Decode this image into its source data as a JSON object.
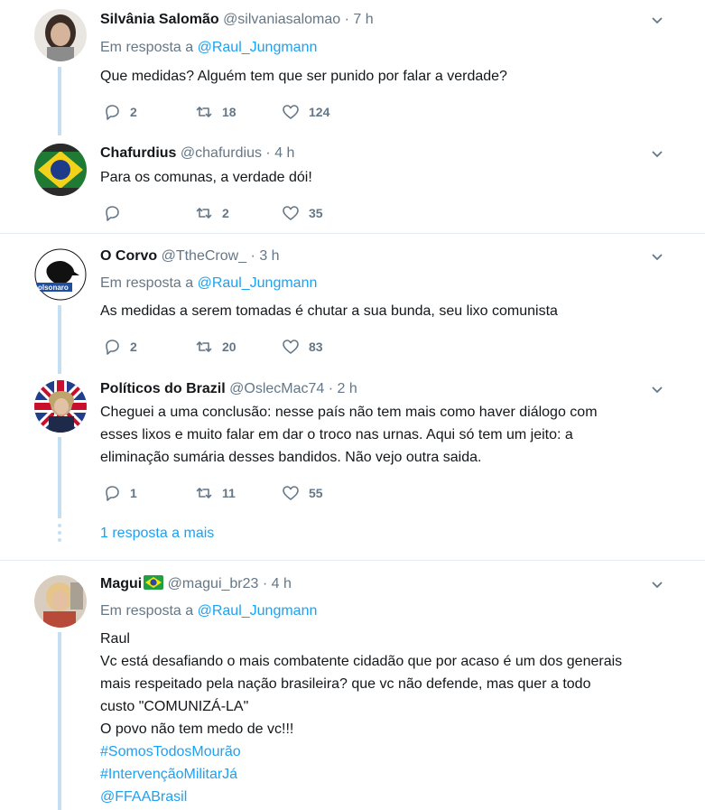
{
  "tweets": [
    {
      "name": "Silvânia Salomão",
      "handle": "@silvaniasalomao",
      "time": "7 h",
      "reply_prefix": "Em resposta a",
      "reply_to": "@Raul_Jungmann",
      "text": [
        "Que medidas? Alguém tem que ser punido por falar a verdade?"
      ],
      "replies": "2",
      "retweets": "18",
      "likes": "124"
    },
    {
      "name": "Chafurdius",
      "handle": "@chafurdius",
      "time": "4 h",
      "text": [
        "Para os comunas, a verdade dói!"
      ],
      "replies": "",
      "retweets": "2",
      "likes": "35"
    },
    {
      "name": "O Corvo",
      "handle": "@TtheCrow_",
      "time": "3 h",
      "reply_prefix": "Em resposta a",
      "reply_to": "@Raul_Jungmann",
      "text": [
        "As medidas a serem tomadas é chutar a sua bunda, seu lixo comunista"
      ],
      "replies": "2",
      "retweets": "20",
      "likes": "83",
      "avatar_text": "olsonaro"
    },
    {
      "name": "Políticos do Brazil",
      "handle": "@OslecMac74",
      "time": "2 h",
      "text": [
        "Cheguei a uma conclusão: nesse país não tem mais como haver diálogo com",
        "esses lixos e muito falar em dar o troco nas urnas. Aqui só tem um jeito: a",
        "eliminação sumária desses bandidos. Não vejo outra saida."
      ],
      "replies": "1",
      "retweets": "11",
      "likes": "55"
    },
    {
      "name": "Magui",
      "name_emoji": "brazil-flag-emoji",
      "handle": "@magui_br23",
      "time": "4 h",
      "reply_prefix": "Em resposta a",
      "reply_to": "@Raul_Jungmann",
      "text": [
        "Raul",
        "Vc está desafiando o mais combatente cidadão que por acaso é um dos generais",
        "mais respeitado pela nação brasileira? que vc não defende, mas quer a todo",
        "custo \"COMUNIZÁ-LA\"",
        "O povo não tem medo de vc!!!"
      ],
      "hashtags": [
        "#SomosTodosMourão",
        "#IntervençãoMilitarJá",
        "@FFAABrasil"
      ]
    }
  ],
  "more_replies": "1 resposta a mais",
  "separator_dot": "·",
  "colors": {
    "link": "#1da1f2",
    "muted": "#657786",
    "thread": "#c4dff2",
    "separator": "#e6ecf0"
  }
}
